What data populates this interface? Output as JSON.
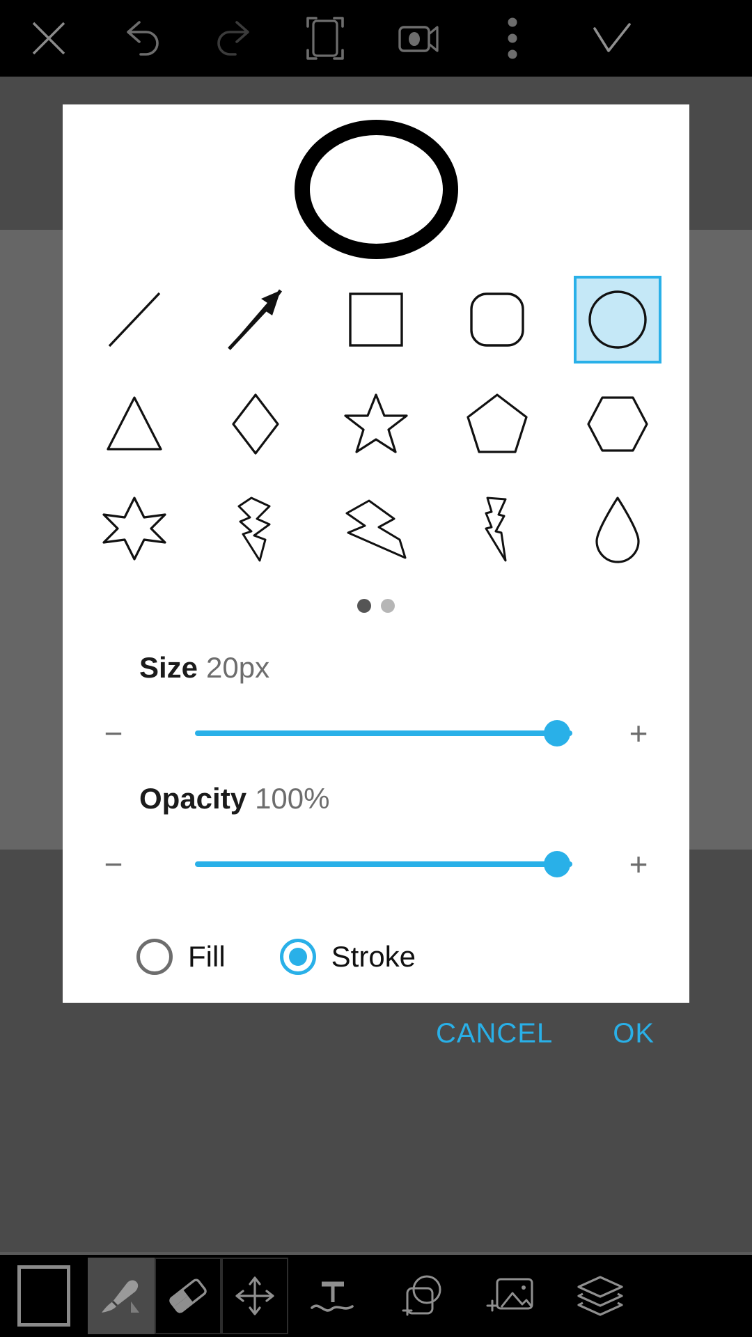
{
  "app": {
    "accent_color": "#29b0e8",
    "selected_chip_fill": "#c5e8f7",
    "backdrop_color": "#666666",
    "toolbar_color": "#000000"
  },
  "topbar": {
    "items": [
      {
        "name": "close-icon",
        "label": "Close"
      },
      {
        "name": "undo-icon",
        "label": "Undo"
      },
      {
        "name": "redo-icon",
        "label": "Redo"
      },
      {
        "name": "crop-icon",
        "label": "Crop"
      },
      {
        "name": "video-icon",
        "label": "Record"
      },
      {
        "name": "more-options-icon",
        "label": "More options"
      },
      {
        "name": "confirm-icon",
        "label": "Done"
      }
    ]
  },
  "dialog": {
    "preview": {
      "shape": "circle",
      "mode": "stroke"
    },
    "shapes": {
      "rows": [
        [
          {
            "name": "line-shape",
            "label": "Line",
            "selected": false
          },
          {
            "name": "arrow-shape",
            "label": "Arrow",
            "selected": false
          },
          {
            "name": "rectangle-shape",
            "label": "Rectangle",
            "selected": false
          },
          {
            "name": "rounded-rect-shape",
            "label": "Rounded rectangle",
            "selected": false
          },
          {
            "name": "circle-shape",
            "label": "Circle",
            "selected": true
          }
        ],
        [
          {
            "name": "triangle-shape",
            "label": "Triangle",
            "selected": false
          },
          {
            "name": "diamond-shape",
            "label": "Diamond",
            "selected": false
          },
          {
            "name": "star-shape",
            "label": "Star",
            "selected": false
          },
          {
            "name": "pentagon-shape",
            "label": "Pentagon",
            "selected": false
          },
          {
            "name": "hexagon-shape",
            "label": "Hexagon",
            "selected": false
          }
        ],
        [
          {
            "name": "six-point-star-shape",
            "label": "Six-pointed star",
            "selected": false
          },
          {
            "name": "lightning-bolt-1-shape",
            "label": "Lightning bolt",
            "selected": false
          },
          {
            "name": "lightning-bolt-2-shape",
            "label": "Lightning bolt wide",
            "selected": false
          },
          {
            "name": "lightning-bolt-3-shape",
            "label": "Lightning bolt thin",
            "selected": false
          },
          {
            "name": "teardrop-shape",
            "label": "Teardrop",
            "selected": false
          }
        ]
      ]
    },
    "pager": {
      "total": 2,
      "active_index": 0
    },
    "size": {
      "label": "Size",
      "value": "20px",
      "fill_percent": 96,
      "decrease_label": "−",
      "increase_label": "+"
    },
    "opacity": {
      "label": "Opacity",
      "value": "100%",
      "fill_percent": 96,
      "decrease_label": "−",
      "increase_label": "+"
    },
    "paint_mode": {
      "options": [
        {
          "name": "fill-radio",
          "label": "Fill",
          "selected": false
        },
        {
          "name": "stroke-radio",
          "label": "Stroke",
          "selected": true
        }
      ]
    },
    "actions": {
      "cancel_label": "CANCEL",
      "ok_label": "OK"
    }
  },
  "bottombar": {
    "color_swatch": {
      "name": "color-swatch",
      "label": "Color"
    },
    "tools": [
      {
        "name": "brush-tool",
        "label": "Brush",
        "active": true
      },
      {
        "name": "eraser-tool",
        "label": "Eraser",
        "active": false
      },
      {
        "name": "move-tool",
        "label": "Move",
        "active": false
      }
    ],
    "items": [
      {
        "name": "text-tool-icon",
        "label": "Text"
      },
      {
        "name": "add-shape-icon",
        "label": "Add shape"
      },
      {
        "name": "add-image-icon",
        "label": "Add image"
      },
      {
        "name": "layers-icon",
        "label": "Layers"
      }
    ]
  }
}
